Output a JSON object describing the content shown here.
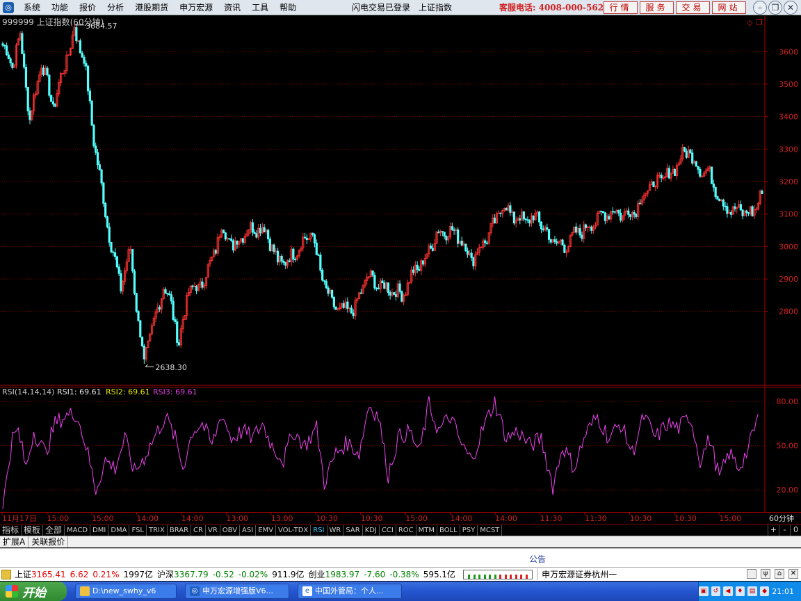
{
  "menu": {
    "items": [
      "系统",
      "功能",
      "报价",
      "分析",
      "港股期货",
      "申万宏源",
      "资讯",
      "工具",
      "帮助"
    ],
    "status_items": [
      "闪电交易已登录",
      "上证指数"
    ],
    "hotline": "客服电话: 4008-000-562",
    "quick_buttons": [
      "行情",
      "服务",
      "交易",
      "网站"
    ]
  },
  "chart": {
    "title": "999999 上证指数(60分钟)",
    "high_label": "3684.57",
    "low_label": "2638.30",
    "y_ticks": [
      3600,
      3500,
      3400,
      3300,
      3200,
      3100,
      3000,
      2900,
      2800
    ],
    "x_labels": [
      "11月17日",
      "15:00",
      "15:00",
      "14:00",
      "14:00",
      "13:00",
      "13:00",
      "10:30",
      "10:30",
      "15:00",
      "14:00",
      "14:00",
      "11:30",
      "11:30",
      "10:30",
      "10:30",
      "15:00"
    ],
    "period_label": "60分钟",
    "colors": {
      "up": "#ff3232",
      "down": "#54ffff",
      "grid": "#800000",
      "axis": "#b00000",
      "rsi": "#ee44ee"
    }
  },
  "rsi": {
    "label": "RSI(14,14,14)",
    "rsi1_label": "RSI1: 69.61",
    "rsi2_label": "RSI2: 69.61",
    "rsi3_label": "RSI3: 69.61",
    "y_ticks": [
      "80.00",
      "50.00",
      "20.00"
    ]
  },
  "chart_data": [
    {
      "type": "candlestick",
      "title": "999999 上证指数(60分钟)",
      "ylim": [
        2570,
        3710
      ],
      "extremes": {
        "high": 3684.57,
        "low": 2638.3
      },
      "anchors": [
        {
          "i": 0,
          "p": 3620
        },
        {
          "i": 5,
          "p": 3560
        },
        {
          "i": 9,
          "p": 3650
        },
        {
          "i": 14,
          "p": 3390
        },
        {
          "i": 20,
          "p": 3570
        },
        {
          "i": 26,
          "p": 3430
        },
        {
          "i": 32,
          "p": 3560
        },
        {
          "i": 37,
          "p": 3660
        },
        {
          "i": 42,
          "p": 3580
        },
        {
          "i": 47,
          "p": 3330
        },
        {
          "i": 51,
          "p": 3180
        },
        {
          "i": 56,
          "p": 3000
        },
        {
          "i": 61,
          "p": 2880
        },
        {
          "i": 66,
          "p": 2990
        },
        {
          "i": 70,
          "p": 2760
        },
        {
          "i": 73,
          "p": 2660
        },
        {
          "i": 78,
          "p": 2760
        },
        {
          "i": 83,
          "p": 2880
        },
        {
          "i": 87,
          "p": 2820
        },
        {
          "i": 91,
          "p": 2700
        },
        {
          "i": 96,
          "p": 2870
        },
        {
          "i": 101,
          "p": 2870
        },
        {
          "i": 107,
          "p": 2940
        },
        {
          "i": 113,
          "p": 3060
        },
        {
          "i": 119,
          "p": 3000
        },
        {
          "i": 124,
          "p": 3040
        },
        {
          "i": 130,
          "p": 3060
        },
        {
          "i": 136,
          "p": 3050
        },
        {
          "i": 142,
          "p": 2950
        },
        {
          "i": 148,
          "p": 2960
        },
        {
          "i": 154,
          "p": 3010
        },
        {
          "i": 160,
          "p": 3040
        },
        {
          "i": 164,
          "p": 2920
        },
        {
          "i": 170,
          "p": 2820
        },
        {
          "i": 176,
          "p": 2800
        },
        {
          "i": 182,
          "p": 2810
        },
        {
          "i": 188,
          "p": 2910
        },
        {
          "i": 194,
          "p": 2880
        },
        {
          "i": 200,
          "p": 2870
        },
        {
          "i": 206,
          "p": 2850
        },
        {
          "i": 212,
          "p": 2920
        },
        {
          "i": 218,
          "p": 2960
        },
        {
          "i": 224,
          "p": 3040
        },
        {
          "i": 230,
          "p": 3050
        },
        {
          "i": 236,
          "p": 3030
        },
        {
          "i": 242,
          "p": 2960
        },
        {
          "i": 248,
          "p": 3010
        },
        {
          "i": 254,
          "p": 3070
        },
        {
          "i": 258,
          "p": 3130
        },
        {
          "i": 264,
          "p": 3090
        },
        {
          "i": 270,
          "p": 3080
        },
        {
          "i": 276,
          "p": 3090
        },
        {
          "i": 283,
          "p": 3020
        },
        {
          "i": 290,
          "p": 3000
        },
        {
          "i": 296,
          "p": 3040
        },
        {
          "i": 302,
          "p": 3060
        },
        {
          "i": 308,
          "p": 3090
        },
        {
          "i": 314,
          "p": 3110
        },
        {
          "i": 320,
          "p": 3100
        },
        {
          "i": 326,
          "p": 3110
        },
        {
          "i": 332,
          "p": 3170
        },
        {
          "i": 338,
          "p": 3200
        },
        {
          "i": 344,
          "p": 3220
        },
        {
          "i": 350,
          "p": 3270
        },
        {
          "i": 354,
          "p": 3300
        },
        {
          "i": 359,
          "p": 3240
        },
        {
          "i": 364,
          "p": 3230
        },
        {
          "i": 368,
          "p": 3180
        },
        {
          "i": 372,
          "p": 3130
        },
        {
          "i": 377,
          "p": 3110
        },
        {
          "i": 382,
          "p": 3110
        },
        {
          "i": 387,
          "p": 3100
        },
        {
          "i": 392,
          "p": 3170
        }
      ]
    },
    {
      "type": "line",
      "title": "RSI(14,14,14)",
      "ylim": [
        5,
        90
      ],
      "series": [
        {
          "name": "RSI1",
          "last": 69.61
        }
      ],
      "anchors": [
        {
          "i": 0,
          "v": 5
        },
        {
          "i": 2,
          "v": 30
        },
        {
          "i": 5,
          "v": 55
        },
        {
          "i": 8,
          "v": 60
        },
        {
          "i": 12,
          "v": 35
        },
        {
          "i": 16,
          "v": 60
        },
        {
          "i": 22,
          "v": 45
        },
        {
          "i": 27,
          "v": 65
        },
        {
          "i": 32,
          "v": 70
        },
        {
          "i": 38,
          "v": 72
        },
        {
          "i": 43,
          "v": 50
        },
        {
          "i": 48,
          "v": 20
        },
        {
          "i": 53,
          "v": 40
        },
        {
          "i": 58,
          "v": 35
        },
        {
          "i": 63,
          "v": 55
        },
        {
          "i": 68,
          "v": 32
        },
        {
          "i": 73,
          "v": 42
        },
        {
          "i": 78,
          "v": 55
        },
        {
          "i": 84,
          "v": 70
        },
        {
          "i": 89,
          "v": 55
        },
        {
          "i": 93,
          "v": 35
        },
        {
          "i": 98,
          "v": 60
        },
        {
          "i": 103,
          "v": 65
        },
        {
          "i": 108,
          "v": 50
        },
        {
          "i": 113,
          "v": 72
        },
        {
          "i": 118,
          "v": 55
        },
        {
          "i": 124,
          "v": 60
        },
        {
          "i": 129,
          "v": 55
        },
        {
          "i": 134,
          "v": 65
        },
        {
          "i": 139,
          "v": 50
        },
        {
          "i": 145,
          "v": 40
        },
        {
          "i": 150,
          "v": 60
        },
        {
          "i": 156,
          "v": 50
        },
        {
          "i": 162,
          "v": 62
        },
        {
          "i": 166,
          "v": 25
        },
        {
          "i": 172,
          "v": 45
        },
        {
          "i": 178,
          "v": 52
        },
        {
          "i": 184,
          "v": 45
        },
        {
          "i": 189,
          "v": 78
        },
        {
          "i": 194,
          "v": 70
        },
        {
          "i": 199,
          "v": 30
        },
        {
          "i": 204,
          "v": 55
        },
        {
          "i": 210,
          "v": 60
        },
        {
          "i": 215,
          "v": 45
        },
        {
          "i": 220,
          "v": 78
        },
        {
          "i": 225,
          "v": 60
        },
        {
          "i": 231,
          "v": 70
        },
        {
          "i": 237,
          "v": 50
        },
        {
          "i": 242,
          "v": 40
        },
        {
          "i": 248,
          "v": 62
        },
        {
          "i": 254,
          "v": 80
        },
        {
          "i": 260,
          "v": 55
        },
        {
          "i": 266,
          "v": 60
        },
        {
          "i": 272,
          "v": 50
        },
        {
          "i": 278,
          "v": 55
        },
        {
          "i": 284,
          "v": 22
        },
        {
          "i": 289,
          "v": 50
        },
        {
          "i": 295,
          "v": 35
        },
        {
          "i": 301,
          "v": 58
        },
        {
          "i": 307,
          "v": 70
        },
        {
          "i": 313,
          "v": 55
        },
        {
          "i": 319,
          "v": 65
        },
        {
          "i": 325,
          "v": 45
        },
        {
          "i": 331,
          "v": 70
        },
        {
          "i": 337,
          "v": 55
        },
        {
          "i": 343,
          "v": 65
        },
        {
          "i": 349,
          "v": 62
        },
        {
          "i": 355,
          "v": 70
        },
        {
          "i": 360,
          "v": 40
        },
        {
          "i": 365,
          "v": 55
        },
        {
          "i": 370,
          "v": 28
        },
        {
          "i": 375,
          "v": 45
        },
        {
          "i": 380,
          "v": 35
        },
        {
          "i": 385,
          "v": 48
        },
        {
          "i": 390,
          "v": 70
        }
      ]
    }
  ],
  "indicator_tabs": [
    "指标",
    "模板",
    "全部",
    "MACD",
    "DMI",
    "DMA",
    "FSL",
    "TRIX",
    "BRAR",
    "CR",
    "VR",
    "OBV",
    "ASI",
    "EMV",
    "VOL-TDX",
    "RSI",
    "WR",
    "SAR",
    "KDJ",
    "CCI",
    "ROC",
    "MTM",
    "BOLL",
    "PSY",
    "MCST"
  ],
  "indicator_right": [
    "+",
    "-",
    "0"
  ],
  "sub_tabs": [
    "扩展A",
    "关联报价"
  ],
  "notice": "公告",
  "ticker": {
    "sh_name": "上证",
    "sh_price": "3165.41",
    "sh_change": "6.62",
    "sh_pct": "0.21%",
    "sh_vol": "1997亿",
    "hs_name": "沪深",
    "hs_price": "3367.79",
    "hs_change": "-0.52",
    "hs_pct": "-0.02%",
    "hs_vol": "911.9亿",
    "cy_name": "创业",
    "cy_price": "1983.97",
    "cy_change": "-7.60",
    "cy_pct": "-0.38%",
    "cy_vol": "595.1亿",
    "broker": "申万宏源证券杭州一"
  },
  "taskbar": {
    "start": "开始",
    "tasks": [
      "D:\\new_swhy_v6",
      "申万宏源增强版V6...",
      "中国外管局：个人..."
    ],
    "clock": "21:01"
  }
}
